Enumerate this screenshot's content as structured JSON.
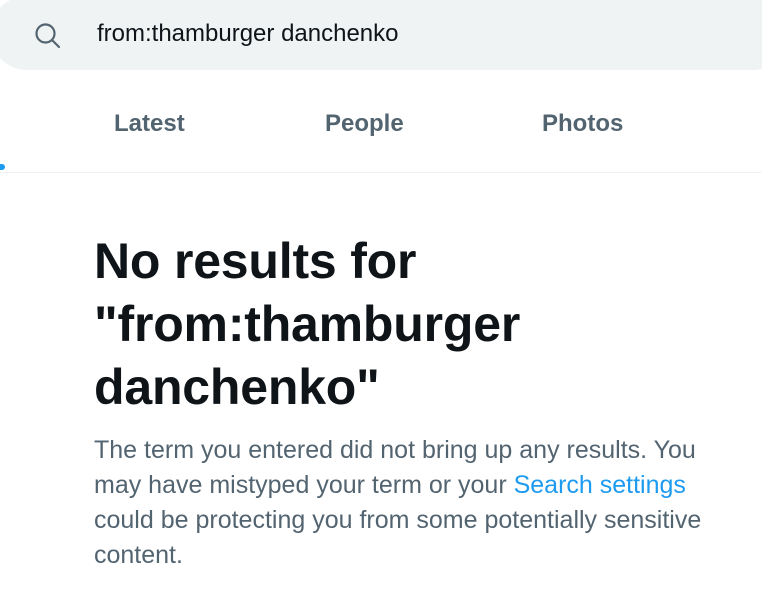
{
  "search": {
    "value": "from:thamburger danchenko",
    "icon": "search-icon"
  },
  "tabs": [
    {
      "label": "Latest"
    },
    {
      "label": "People"
    },
    {
      "label": "Photos"
    }
  ],
  "empty_state": {
    "title_line1": "No results for",
    "title_line2": "\"from:thamburger",
    "title_line3": "danchenko\"",
    "body_part1": "The term you entered did not bring up any results. You may have mistyped your term or your ",
    "link_text": "Search settings",
    "body_part2": " could be protecting you from some potentially sensitive content."
  },
  "colors": {
    "accent": "#1d9bf0",
    "secondary_text": "#536471",
    "primary_text": "#0f1419",
    "search_background": "#eff3f4"
  }
}
